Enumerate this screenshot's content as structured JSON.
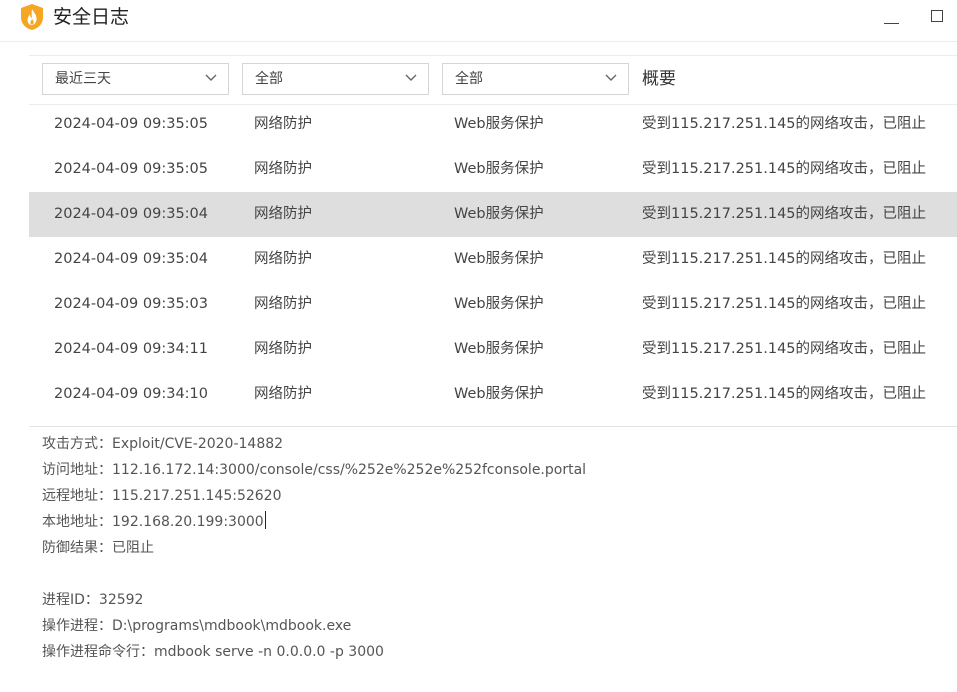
{
  "window": {
    "title": "安全日志",
    "logo_icon": "shield-flame-icon",
    "accent_color": "#f5a623"
  },
  "filters": {
    "time_range": "最近三天",
    "category": "全部",
    "subcategory": "全部",
    "summary_header": "概要"
  },
  "rows": [
    {
      "time": "2024-04-09 09:35:05",
      "type": "网络防护",
      "sub": "Web服务保护",
      "summary": "受到115.217.251.145的网络攻击，已阻止"
    },
    {
      "time": "2024-04-09 09:35:05",
      "type": "网络防护",
      "sub": "Web服务保护",
      "summary": "受到115.217.251.145的网络攻击，已阻止"
    },
    {
      "time": "2024-04-09 09:35:04",
      "type": "网络防护",
      "sub": "Web服务保护",
      "summary": "受到115.217.251.145的网络攻击，已阻止"
    },
    {
      "time": "2024-04-09 09:35:04",
      "type": "网络防护",
      "sub": "Web服务保护",
      "summary": "受到115.217.251.145的网络攻击，已阻止"
    },
    {
      "time": "2024-04-09 09:35:03",
      "type": "网络防护",
      "sub": "Web服务保护",
      "summary": "受到115.217.251.145的网络攻击，已阻止"
    },
    {
      "time": "2024-04-09 09:34:11",
      "type": "网络防护",
      "sub": "Web服务保护",
      "summary": "受到115.217.251.145的网络攻击，已阻止"
    },
    {
      "time": "2024-04-09 09:34:10",
      "type": "网络防护",
      "sub": "Web服务保护",
      "summary": "受到115.217.251.145的网络攻击，已阻止"
    }
  ],
  "selected_row": 2,
  "details": {
    "attack_method": {
      "label": "攻击方式：",
      "value": "Exploit/CVE-2020-14882"
    },
    "access_url": {
      "label": "访问地址：",
      "value": "112.16.172.14:3000/console/css/%252e%252e%252fconsole.portal"
    },
    "remote_addr": {
      "label": "远程地址：",
      "value": "115.217.251.145:52620"
    },
    "local_addr": {
      "label": "本地地址：",
      "value": "192.168.20.199:3000"
    },
    "result": {
      "label": "防御结果：",
      "value": "已阻止"
    },
    "pid": {
      "label": "进程ID：",
      "value": "32592"
    },
    "process": {
      "label": "操作进程：",
      "value": "D:\\programs\\mdbook\\mdbook.exe"
    },
    "cmdline": {
      "label": "操作进程命令行：",
      "value": "mdbook  serve -n 0.0.0.0 -p 3000"
    }
  }
}
